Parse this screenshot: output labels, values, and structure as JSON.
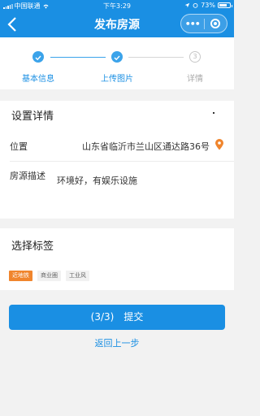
{
  "status_bar": {
    "carrier": "中国联通",
    "time": "下午3:29",
    "battery": "73%",
    "battery_level": 0.73
  },
  "nav": {
    "title": "发布房源",
    "back_icon": "chevron-left-icon",
    "more_icon": "more-dots-icon",
    "close_icon": "target-circle-icon",
    "more_glyph": "•••"
  },
  "steps": {
    "items": [
      {
        "label": "基本信息",
        "state": "done"
      },
      {
        "label": "上传图片",
        "state": "done"
      },
      {
        "label": "详情",
        "state": "pending",
        "number": "3"
      }
    ]
  },
  "details": {
    "title": "设置详情",
    "location_label": "位置",
    "location_value": "山东省临沂市兰山区通达路36号",
    "description_label": "房源描述",
    "description_value": "环境好，有娱乐设施"
  },
  "tags": {
    "title": "选择标签",
    "items": [
      {
        "label": "近地铁",
        "selected": true
      },
      {
        "label": "商业圈",
        "selected": false
      },
      {
        "label": "工业风",
        "selected": false
      }
    ]
  },
  "actions": {
    "submit_label": "(3/3)　提交",
    "back_label": "返回上一步"
  },
  "colors": {
    "primary": "#1a8fe3",
    "step_active": "#3ba3ea",
    "pin": "#f0852d",
    "tag_selected": "#f0852d"
  }
}
